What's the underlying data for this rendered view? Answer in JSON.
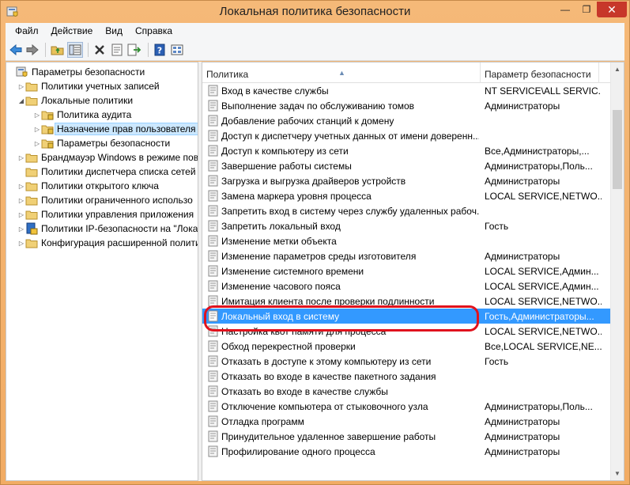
{
  "window": {
    "title": "Локальная политика безопасности",
    "min_glyph": "—",
    "max_glyph": "❐",
    "close_glyph": "✕"
  },
  "menu": [
    "Файл",
    "Действие",
    "Вид",
    "Справка"
  ],
  "toolbar": {
    "icons": [
      "back-icon",
      "forward-icon",
      "folder-up-icon",
      "show-tree-icon",
      "delete-icon",
      "properties-icon",
      "export-icon",
      "help-icon",
      "view-icon"
    ]
  },
  "tree": {
    "items": [
      {
        "label": "Параметры безопасности",
        "indent": 0,
        "arrow": "",
        "icon": "security-settings-icon"
      },
      {
        "label": "Политики учетных записей",
        "indent": 1,
        "arrow": "▷",
        "icon": "folder-icon"
      },
      {
        "label": "Локальные политики",
        "indent": 1,
        "arrow": "◢",
        "icon": "folder-icon"
      },
      {
        "label": "Политика аудита",
        "indent": 2,
        "arrow": "▷",
        "icon": "folder-icon"
      },
      {
        "label": "Назначение прав пользователя",
        "indent": 2,
        "arrow": "▷",
        "icon": "folder-icon",
        "selected": true
      },
      {
        "label": "Параметры безопасности",
        "indent": 2,
        "arrow": "▷",
        "icon": "folder-icon"
      },
      {
        "label": "Брандмауэр Windows в режиме пов",
        "indent": 1,
        "arrow": "▷",
        "icon": "folder-icon"
      },
      {
        "label": "Политики диспетчера списка сетей",
        "indent": 1,
        "arrow": "",
        "icon": "folder-icon"
      },
      {
        "label": "Политики открытого ключа",
        "indent": 1,
        "arrow": "▷",
        "icon": "folder-icon"
      },
      {
        "label": "Политики ограниченного использо",
        "indent": 1,
        "arrow": "▷",
        "icon": "folder-icon"
      },
      {
        "label": "Политики управления приложения",
        "indent": 1,
        "arrow": "▷",
        "icon": "folder-icon"
      },
      {
        "label": "Политики IP-безопасности на \"Лока",
        "indent": 1,
        "arrow": "▷",
        "icon": "ipsec-icon"
      },
      {
        "label": "Конфигурация расширенной полити",
        "indent": 1,
        "arrow": "▷",
        "icon": "folder-icon"
      }
    ]
  },
  "list": {
    "columns": [
      "Политика",
      "Параметр безопасности"
    ],
    "sort_glyph": "▲",
    "rows": [
      {
        "policy": "Вход в качестве службы",
        "value": "NT SERVICE\\ALL SERVIC..."
      },
      {
        "policy": "Выполнение задач по обслуживанию томов",
        "value": "Администраторы"
      },
      {
        "policy": "Добавление рабочих станций к домену",
        "value": ""
      },
      {
        "policy": "Доступ к диспетчеру учетных данных от имени доверенн...",
        "value": ""
      },
      {
        "policy": "Доступ к компьютеру из сети",
        "value": "Все,Администраторы,..."
      },
      {
        "policy": "Завершение работы системы",
        "value": "Администраторы,Поль..."
      },
      {
        "policy": "Загрузка и выгрузка драйверов устройств",
        "value": "Администраторы"
      },
      {
        "policy": "Замена маркера уровня процесса",
        "value": "LOCAL SERVICE,NETWO..."
      },
      {
        "policy": "Запретить вход в систему через службу удаленных рабоч...",
        "value": ""
      },
      {
        "policy": "Запретить локальный вход",
        "value": "Гость"
      },
      {
        "policy": "Изменение метки объекта",
        "value": ""
      },
      {
        "policy": "Изменение параметров среды изготовителя",
        "value": "Администраторы"
      },
      {
        "policy": "Изменение системного времени",
        "value": "LOCAL SERVICE,Админ..."
      },
      {
        "policy": "Изменение часового пояса",
        "value": "LOCAL SERVICE,Админ..."
      },
      {
        "policy": "Имитация клиента после проверки подлинности",
        "value": "LOCAL SERVICE,NETWO..."
      },
      {
        "policy": "Локальный вход в систему",
        "value": "Гость,Администраторы...",
        "selected": true
      },
      {
        "policy": "Настройка квот памяти для процесса",
        "value": "LOCAL SERVICE,NETWO..."
      },
      {
        "policy": "Обход перекрестной проверки",
        "value": "Все,LOCAL SERVICE,NE..."
      },
      {
        "policy": "Отказать в доступе к этому компьютеру из сети",
        "value": "Гость"
      },
      {
        "policy": "Отказать во входе в качестве пакетного задания",
        "value": ""
      },
      {
        "policy": "Отказать во входе в качестве службы",
        "value": ""
      },
      {
        "policy": "Отключение компьютера от стыковочного узла",
        "value": "Администраторы,Поль..."
      },
      {
        "policy": "Отладка программ",
        "value": "Администраторы"
      },
      {
        "policy": "Принудительное удаленное завершение работы",
        "value": "Администраторы"
      },
      {
        "policy": "Профилирование одного процесса",
        "value": "Администраторы"
      }
    ]
  },
  "colors": {
    "title_bar": "#f5b978",
    "selection": "#3399ff",
    "highlight_ring": "#e0121d",
    "close_button": "#c7372a"
  }
}
